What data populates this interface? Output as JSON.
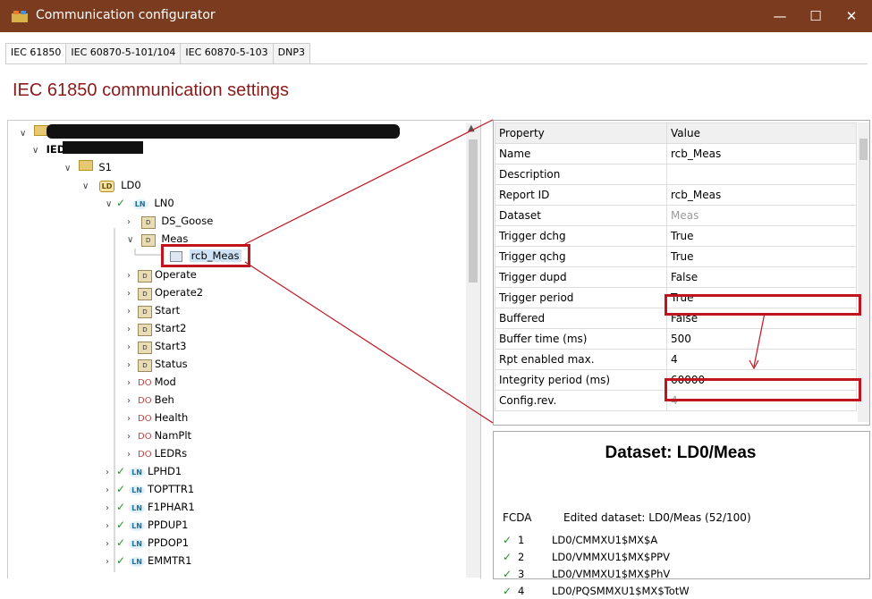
{
  "window": {
    "title": "Communication configurator",
    "maximize_glyph": "☐",
    "close_glyph": "✕"
  },
  "tabs": [
    "IEC 61850",
    "IEC 60870-5-101/104",
    "IEC 60870-5-103",
    "DNP3"
  ],
  "heading": "IEC 61850 communication settings",
  "tree": {
    "ied_label": "IED",
    "s1": "S1",
    "ld0": "LD0",
    "ld_badge": "LD",
    "ln_badge": "LN",
    "do_tag": "DO",
    "ds_badge": "D",
    "ln0": "LN0",
    "ds_goose": "DS_Goose",
    "meas": "Meas",
    "rcb_meas": "rcb_Meas",
    "datasets": [
      "Operate",
      "Operate2",
      "Start",
      "Start2",
      "Start3",
      "Status"
    ],
    "data_objects": [
      "Mod",
      "Beh",
      "Health",
      "NamPlt",
      "LEDRs"
    ],
    "logical_nodes": [
      "LPHD1",
      "TOPTTR1",
      "F1PHAR1",
      "PPDUP1",
      "PPDOP1",
      "EMMTR1"
    ]
  },
  "properties": {
    "header": {
      "property": "Property",
      "value": "Value"
    },
    "rows": [
      {
        "key": "Name",
        "value": "rcb_Meas",
        "disabled": false
      },
      {
        "key": "Description",
        "value": "",
        "disabled": false
      },
      {
        "key": "Report ID",
        "value": "rcb_Meas",
        "disabled": false
      },
      {
        "key": "Dataset",
        "value": "Meas",
        "disabled": true
      },
      {
        "key": "Trigger dchg",
        "value": "True",
        "disabled": false
      },
      {
        "key": "Trigger qchg",
        "value": "True",
        "disabled": false
      },
      {
        "key": "Trigger dupd",
        "value": "False",
        "disabled": false
      },
      {
        "key": "Trigger period",
        "value": "True",
        "disabled": false
      },
      {
        "key": "Buffered",
        "value": "False",
        "disabled": false
      },
      {
        "key": "Buffer time (ms)",
        "value": "500",
        "disabled": false
      },
      {
        "key": "Rpt enabled max.",
        "value": "4",
        "disabled": false
      },
      {
        "key": "Integrity period (ms)",
        "value": "60000",
        "disabled": false
      },
      {
        "key": "Config.rev.",
        "value": "4",
        "disabled": true
      }
    ]
  },
  "dataset": {
    "title": "Dataset: LD0/Meas",
    "fcda_header": "FCDA",
    "edited": "Edited dataset: LD0/Meas   (52/100)",
    "items": [
      {
        "n": "1",
        "path": "LD0/CMMXU1$MX$A"
      },
      {
        "n": "2",
        "path": "LD0/VMMXU1$MX$PPV"
      },
      {
        "n": "3",
        "path": "LD0/VMMXU1$MX$PhV"
      },
      {
        "n": "4",
        "path": "LD0/PQSMMXU1$MX$TotW"
      }
    ]
  },
  "colors": {
    "titlebar": "#7a3b1e",
    "heading": "#8b1a1a",
    "annotation": "#c0141e",
    "check": "#2a8a2a"
  }
}
